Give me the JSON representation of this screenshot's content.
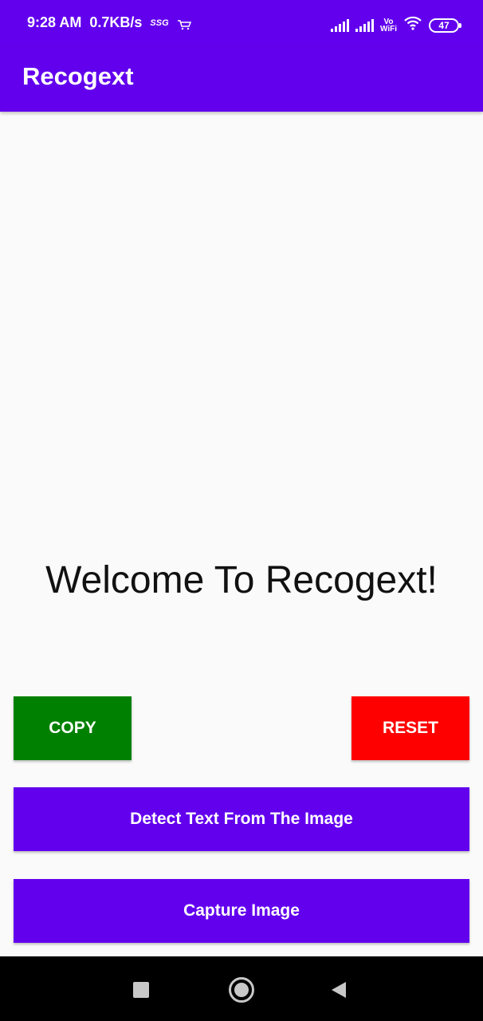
{
  "status_bar": {
    "time": "9:28 AM",
    "speed": "0.7KB/s",
    "carrier_badge": "SSG",
    "icons": [
      "amazon-cart-icon",
      "signal-icon",
      "signal-icon",
      "vowifi-icon",
      "wifi-icon",
      "battery-icon"
    ],
    "vo_label": "Vo",
    "wifi_label": "WiFi",
    "battery_level": "47"
  },
  "app_bar": {
    "title": "Recogext"
  },
  "main": {
    "welcome_text": "Welcome To Recogext!"
  },
  "buttons": {
    "copy_label": "COPY",
    "reset_label": "RESET",
    "detect_label": "Detect Text From The Image",
    "capture_label": "Capture Image"
  },
  "nav_bar": {
    "icons": [
      "recents-icon",
      "home-icon",
      "back-icon"
    ]
  },
  "colors": {
    "primary": "#6200ee",
    "copy": "#008000",
    "reset": "#ff0000",
    "background": "#fafafa"
  }
}
